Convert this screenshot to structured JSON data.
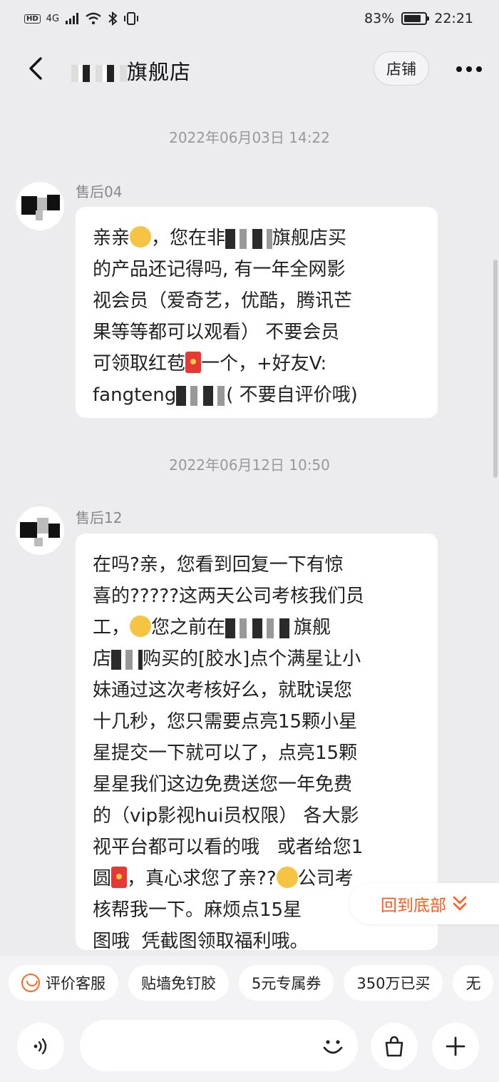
{
  "status_bar": {
    "hd": "HD",
    "network": "4G",
    "battery_percent": "83%",
    "battery_level": 0.83,
    "time": "22:21"
  },
  "nav": {
    "store_name_visible": "旗舰店",
    "shop_button": "店铺",
    "more_icon": "more-dots-icon",
    "back_icon": "chevron-left-icon"
  },
  "messages": [
    {
      "timestamp": "2022年06月03日 14:22",
      "sender": "售后04",
      "lines": [
        "亲亲",
        "，您在非",
        "旗舰店买",
        "的产品还记得吗, 有一年全网影",
        "视会员（爱奇艺，优酷，腾讯芒",
        "果等等都可以观看） 不要会员",
        "可领取红苞",
        "一个，+好友V:",
        "fangteng",
        "( 不要自评价哦)"
      ]
    },
    {
      "timestamp": "2022年06月12日 10:50",
      "sender": "售后12",
      "lines": [
        "在吗?亲，您看到回复一下有惊",
        "喜的?????这两天公司考核我们员",
        "工，",
        "您之前在",
        "旗舰",
        "店",
        "购买的[胶水]点个满星让小",
        "妹通过这次考核好么，就耽误您",
        "十几秒，您只需要点亮15颗小星",
        "星提交一下就可以了，点亮15颗",
        "星星我们这边免费送您一年免费",
        "的（vip影视hui员权限） 各大影",
        "视平台都可以看的哦   或者给您1",
        "圆",
        "，真心求您了亲??",
        "公司考",
        "核帮我一下。麻烦点15星",
        "图哦  凭截图领取福利哦。"
      ]
    }
  ],
  "back_to_bottom": "回到底部",
  "quick_chips": [
    "评价客服",
    "贴墙免钉胶",
    "5元专属券",
    "350万已买",
    "无"
  ],
  "input": {
    "placeholder": ""
  },
  "colors": {
    "accent": "#ff5a1f",
    "background": "#ececee",
    "bubble": "#ffffff"
  }
}
